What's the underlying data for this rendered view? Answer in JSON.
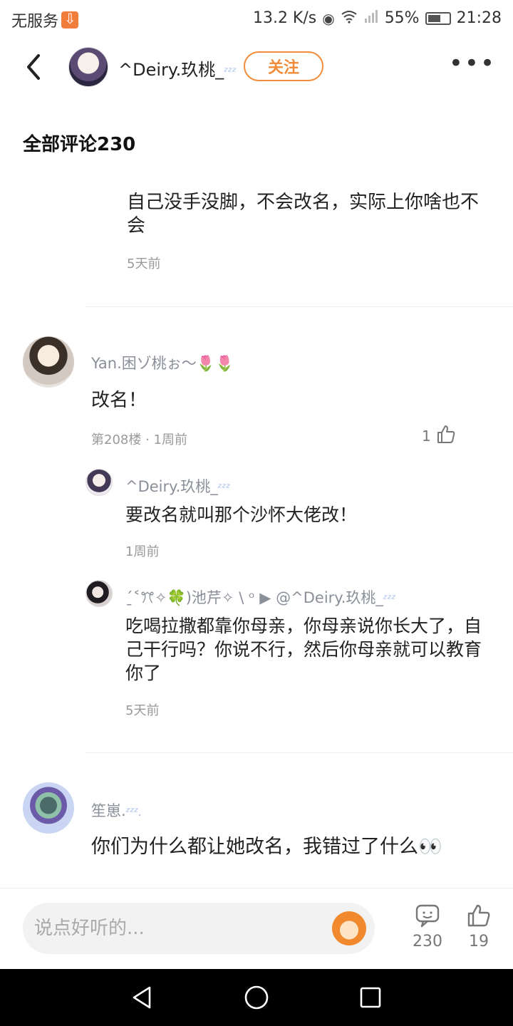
{
  "status_bar": {
    "carrier": "无服务",
    "speed": "13.2 K/s",
    "battery": "55%",
    "time": "21:28",
    "icons": [
      "download-icon",
      "eye-icon",
      "wifi-icon",
      "signal-icon",
      "battery-icon"
    ]
  },
  "header": {
    "username": "^Deiry.玖桃_",
    "follow_label": "关注",
    "more_label": "•••"
  },
  "section_title": "全部评论230",
  "comments": [
    {
      "text": "自己没手没脚，不会改名，实际上你啥也不会",
      "time": "5天前"
    },
    {
      "name": "Yan.困ゾ桃ぉ～",
      "text": "改名！",
      "meta": "第208楼 · 1周前",
      "likes": "1",
      "replies": [
        {
          "name": "^Deiry.玖桃_",
          "text": "要改名就叫那个沙怀大佬改！",
          "time": "1周前"
        },
        {
          "name": "ˊ̱˂ꔫ✧🍀)池芹✧ \\ ᵒ ▶ @^Deiry.玖桃_",
          "text": "吃喝拉撒都靠你母亲，你母亲说你长大了，自己干行吗？你说不行，然后你母亲就可以教育你了",
          "time": "5天前"
        }
      ]
    },
    {
      "name": "笙崽.",
      "text": "你们为什么都让她改名，我错过了什么👀"
    }
  ],
  "bottom_bar": {
    "placeholder": "说点好听的...",
    "comment_count": "230",
    "like_count": "19"
  },
  "colors": {
    "accent": "#f28c3a",
    "name_gray": "#8a8f99",
    "meta_gray": "#999999"
  }
}
